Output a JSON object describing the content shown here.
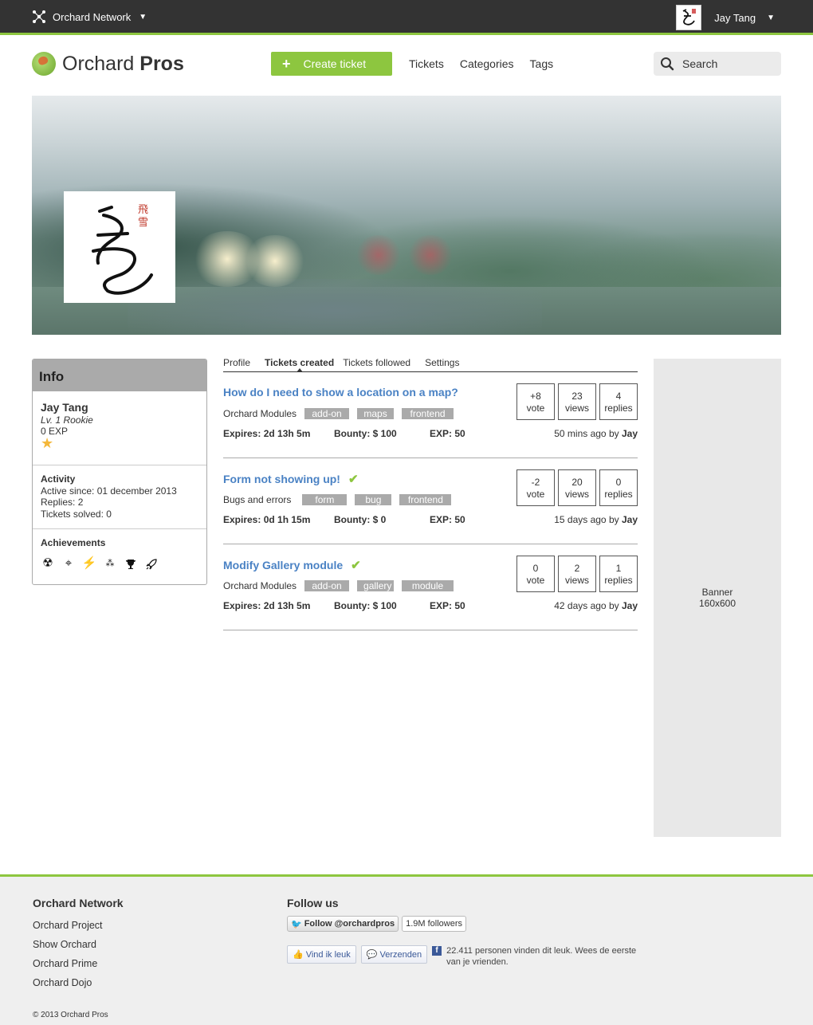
{
  "topbar": {
    "network_label": "Orchard Network",
    "user_name": "Jay Tang",
    "caret": "▼"
  },
  "header": {
    "logo_light": "Orchard",
    "logo_bold": "Pros",
    "create_label": "Create ticket",
    "nav": [
      "Tickets",
      "Categories",
      "Tags"
    ],
    "search_placeholder": "Search"
  },
  "info": {
    "title": "Info",
    "name": "Jay Tang",
    "level": "Lv. 1 Rookie",
    "exp": "0 EXP",
    "activity_title": "Activity",
    "active_since": "Active since: 01 december 2013",
    "replies": "Replies: 2",
    "tickets_solved": "Tickets solved: 0",
    "achievements_title": "Achievements",
    "achievements": [
      "radiation-icon",
      "crosshair-icon",
      "lightning-icon",
      "stars-icon",
      "trophy-icon",
      "rocket-icon"
    ]
  },
  "tabs": [
    "Profile",
    "Tickets created",
    "Tickets followed",
    "Settings"
  ],
  "active_tab": 1,
  "tickets": [
    {
      "title": "How do I need to show a location on a map?",
      "solved": false,
      "category": "Orchard Modules",
      "tags": [
        "add-on",
        "maps",
        "frontend"
      ],
      "expires": "Expires: 2d 13h 5m",
      "bounty": "Bounty: $ 100",
      "exp": "EXP: 50",
      "votes": "+8",
      "votes_label": "vote",
      "views": "23",
      "views_label": "views",
      "replies": "4",
      "replies_label": "replies",
      "ago": "50 mins ago by",
      "author": "Jay"
    },
    {
      "title": "Form not showing up!",
      "solved": true,
      "category": "Bugs and errors",
      "tags": [
        "form",
        "bug",
        "frontend"
      ],
      "expires": "Expires: 0d 1h 15m",
      "bounty": "Bounty: $ 0",
      "exp": "EXP: 50",
      "votes": "-2",
      "votes_label": "vote",
      "views": "20",
      "views_label": "views",
      "replies": "0",
      "replies_label": "replies",
      "ago": "15 days ago by",
      "author": "Jay"
    },
    {
      "title": "Modify Gallery module",
      "solved": true,
      "category": "Orchard Modules",
      "tags": [
        "add-on",
        "gallery",
        "module"
      ],
      "expires": "Expires: 2d 13h 5m",
      "bounty": "Bounty: $ 100",
      "exp": "EXP: 50",
      "votes": "0",
      "votes_label": "vote",
      "views": "2",
      "views_label": "views",
      "replies": "1",
      "replies_label": "replies",
      "ago": "42 days ago by",
      "author": "Jay"
    }
  ],
  "ad": {
    "line1": "Banner",
    "line2": "160x600"
  },
  "footer": {
    "network_title": "Orchard Network",
    "links": [
      "Orchard Project",
      "Show Orchard",
      "Orchard Prime",
      "Orchard Dojo"
    ],
    "follow_title": "Follow us",
    "twitter_button": "Follow @orchardpros",
    "twitter_count": "1.9M followers",
    "fb_like": "Vind ik leuk",
    "fb_send": "Verzenden",
    "fb_text": "22.411 personen vinden dit leuk. Wees de eerste van je vrienden.",
    "copyright": "© 2013 Orchard Pros"
  },
  "colors": {
    "accent": "#8dc63f",
    "link": "#4a82c4",
    "topbar": "#333333"
  }
}
